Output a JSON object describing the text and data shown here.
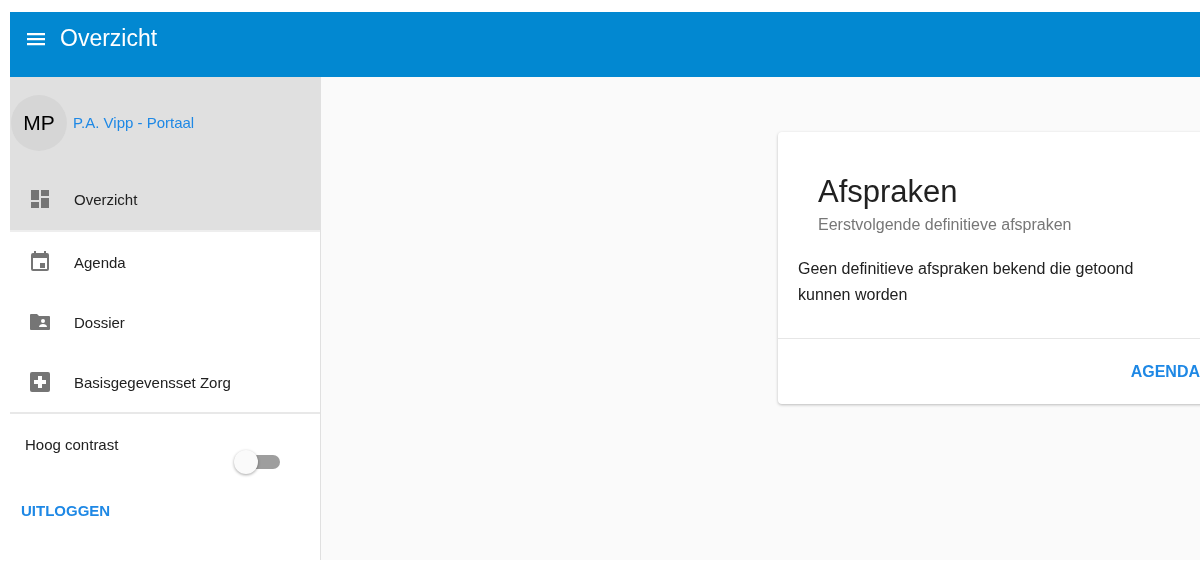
{
  "app_bar": {
    "title": "Overzicht"
  },
  "sidebar": {
    "profile": {
      "initials": "MP",
      "name": "P.A. Vipp - Portaal"
    },
    "items": [
      {
        "label": "Overzicht",
        "kind": "dashboard",
        "selected": true
      },
      {
        "label": "Agenda",
        "kind": "calendar",
        "selected": false
      },
      {
        "label": "Dossier",
        "kind": "folder",
        "selected": false
      },
      {
        "label": "Basisgegevensset Zorg",
        "kind": "medical",
        "selected": false
      }
    ],
    "contrast": {
      "label": "Hoog contrast",
      "on": false
    },
    "logout": "UITLOGGEN"
  },
  "card": {
    "title": "Afspraken",
    "subtitle": "Eerstvolgende definitieve afspraken",
    "body": "Geen definitieve afspraken bekend die getoond kunnen worden",
    "action": "AGENDA"
  }
}
